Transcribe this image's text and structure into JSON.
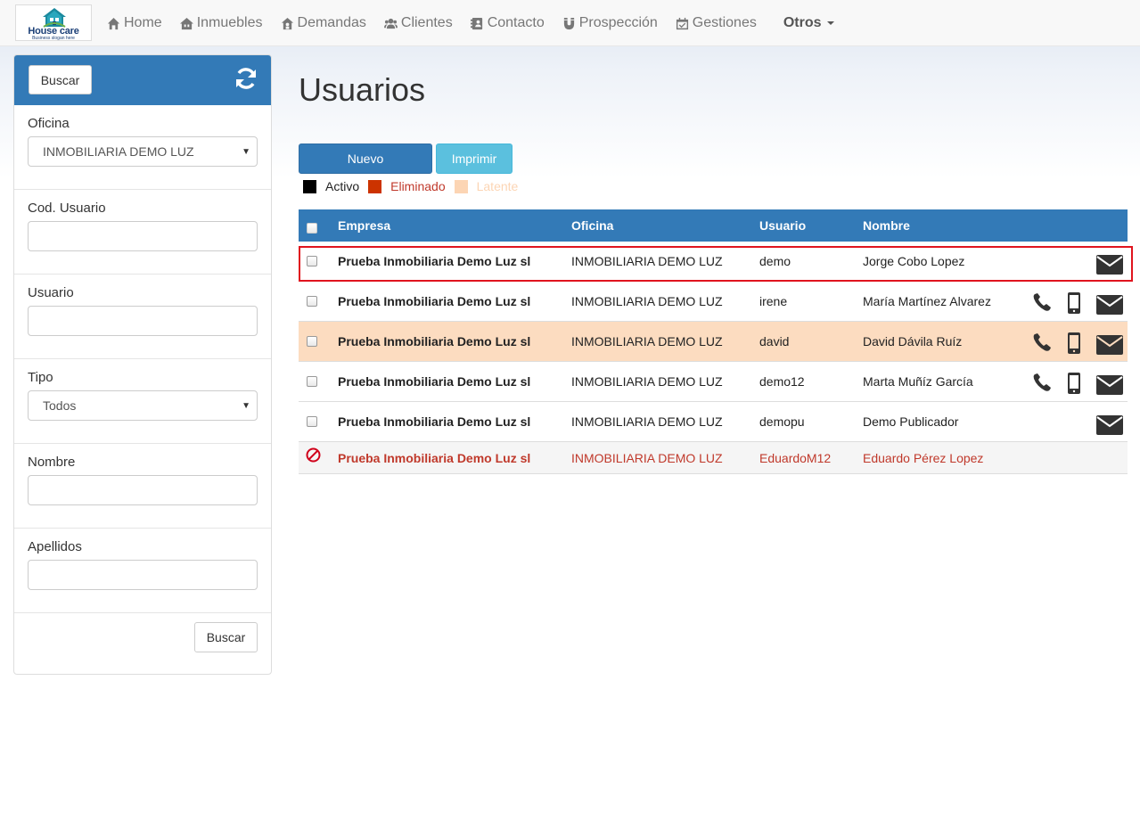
{
  "logo": {
    "brand": "House care",
    "slogan": "Business slogan here"
  },
  "nav": [
    {
      "label": "Home",
      "icon": "home-icon"
    },
    {
      "label": "Inmuebles",
      "icon": "building-icon"
    },
    {
      "label": "Demandas",
      "icon": "house-user-icon"
    },
    {
      "label": "Clientes",
      "icon": "users-icon"
    },
    {
      "label": "Contacto",
      "icon": "address-book-icon"
    },
    {
      "label": "Prospección",
      "icon": "magnet-icon"
    },
    {
      "label": "Gestiones",
      "icon": "calendar-check-icon"
    },
    {
      "label": "Otros"
    }
  ],
  "sidebar": {
    "search_label": "Buscar",
    "fields": {
      "oficina": {
        "label": "Oficina",
        "value": "INMOBILIARIA DEMO LUZ"
      },
      "cod_usuario": {
        "label": "Cod. Usuario",
        "value": ""
      },
      "usuario": {
        "label": "Usuario",
        "value": ""
      },
      "tipo": {
        "label": "Tipo",
        "value": "Todos"
      },
      "nombre": {
        "label": "Nombre",
        "value": ""
      },
      "apellidos": {
        "label": "Apellidos",
        "value": ""
      }
    },
    "footer_search_label": "Buscar"
  },
  "main": {
    "title": "Usuarios",
    "new_label": "Nuevo",
    "print_label": "Imprimir",
    "legend": {
      "activo": {
        "label": "Activo",
        "color": "#000000"
      },
      "eliminado": {
        "label": "Eliminado",
        "color": "#c0392b"
      },
      "latente": {
        "label": "Latente",
        "color": "#fcd5b4"
      }
    }
  },
  "table": {
    "headers": {
      "empresa": "Empresa",
      "oficina": "Oficina",
      "usuario": "Usuario",
      "nombre": "Nombre"
    },
    "rows": [
      {
        "empresa": "Prueba Inmobiliaria Demo Luz sl",
        "oficina": "INMOBILIARIA DEMO LUZ",
        "usuario": "demo",
        "nombre": "Jorge Cobo Lopez",
        "status": "activo"
      },
      {
        "empresa": "Prueba Inmobiliaria Demo Luz sl",
        "oficina": "INMOBILIARIA DEMO LUZ",
        "usuario": "irene",
        "nombre": "María Martínez Alvarez",
        "status": "activo"
      },
      {
        "empresa": "Prueba Inmobiliaria Demo Luz sl",
        "oficina": "INMOBILIARIA DEMO LUZ",
        "usuario": "david",
        "nombre": "David Dávila Ruíz",
        "status": "latente"
      },
      {
        "empresa": "Prueba Inmobiliaria Demo Luz sl",
        "oficina": "INMOBILIARIA DEMO LUZ",
        "usuario": "demo12",
        "nombre": "Marta Muñíz García",
        "status": "activo"
      },
      {
        "empresa": "Prueba Inmobiliaria Demo Luz sl",
        "oficina": "INMOBILIARIA DEMO LUZ",
        "usuario": "demopu",
        "nombre": "Demo Publicador",
        "status": "activo"
      },
      {
        "empresa": "Prueba Inmobiliaria Demo Luz sl",
        "oficina": "INMOBILIARIA DEMO LUZ",
        "usuario": "EduardoM12",
        "nombre": "Eduardo Pérez Lopez",
        "status": "eliminado"
      }
    ]
  },
  "colors": {
    "primary": "#337ab7",
    "info": "#5bc0de",
    "deleted": "#c0392b",
    "latent": "#fcdcc0",
    "highlight": "#e0141e"
  }
}
